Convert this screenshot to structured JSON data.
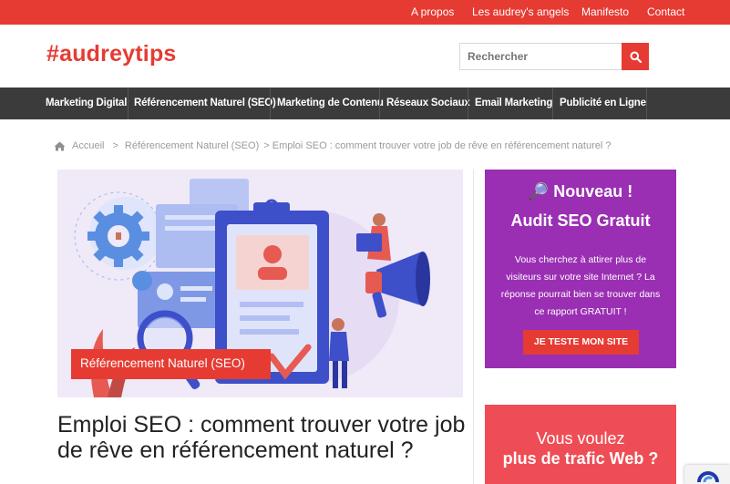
{
  "topbar": {
    "links": [
      "A propos",
      "Les audrey's angels",
      "Manifesto",
      "Contact"
    ]
  },
  "header": {
    "logo": "#audreytips",
    "search_placeholder": "Rechercher"
  },
  "nav": {
    "items": [
      "Marketing Digital",
      "Référencement Naturel (SEO)",
      "Marketing de Contenu",
      "Réseaux Sociaux",
      "Email Marketing",
      "Publicité en Ligne"
    ]
  },
  "breadcrumb": {
    "home": "Accueil",
    "sep": ">",
    "category": "Référencement Naturel (SEO)",
    "current": "> Emploi SEO : comment trouver votre job de rêve en référencement naturel ?"
  },
  "article": {
    "category_tag": "Référencement Naturel (SEO)",
    "title": "Emploi SEO : comment trouver votre job de rêve en référencement naturel ?"
  },
  "sidebar": {
    "promo1": {
      "title": "🔎 Nouveau !",
      "subtitle": "Audit SEO Gratuit",
      "text": "Vous cherchez à attirer plus de visiteurs sur votre site Internet ? La réponse pourrait bien se trouver dans ce rapport GRATUIT !",
      "button": "JE TESTE MON SITE"
    },
    "promo2": {
      "line1": "Vous voulez",
      "line2": "plus de trafic Web ?"
    }
  },
  "colors": {
    "brand_red": "#e63b33",
    "nav_bg": "#3b3b3b",
    "promo_purple": "#9a2fb3",
    "promo_pink": "#ef4d55"
  }
}
